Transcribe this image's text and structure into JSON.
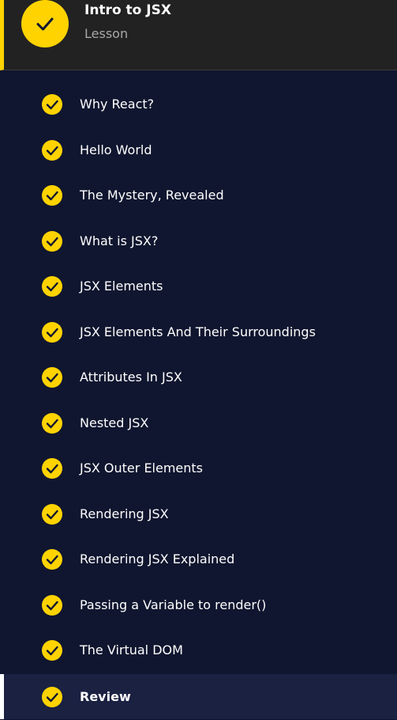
{
  "header": {
    "title": "Intro to JSX",
    "subtitle": "Lesson",
    "badge_icon": "check-icon"
  },
  "colors": {
    "accent": "#ffd300",
    "background": "#10162f",
    "header_bg": "#222222",
    "active_bg": "#1a2141"
  },
  "items": [
    {
      "label": "Why React?",
      "icon": "check-icon",
      "completed": true
    },
    {
      "label": "Hello World",
      "icon": "check-icon",
      "completed": true
    },
    {
      "label": "The Mystery, Revealed",
      "icon": "check-icon",
      "completed": true
    },
    {
      "label": "What is JSX?",
      "icon": "check-icon",
      "completed": true
    },
    {
      "label": "JSX Elements",
      "icon": "check-icon",
      "completed": true
    },
    {
      "label": "JSX Elements And Their Surroundings",
      "icon": "check-icon",
      "completed": true
    },
    {
      "label": "Attributes In JSX",
      "icon": "check-icon",
      "completed": true
    },
    {
      "label": "Nested JSX",
      "icon": "check-icon",
      "completed": true
    },
    {
      "label": "JSX Outer Elements",
      "icon": "check-icon",
      "completed": true
    },
    {
      "label": "Rendering JSX",
      "icon": "check-icon",
      "completed": true
    },
    {
      "label": "Rendering JSX Explained",
      "icon": "check-icon",
      "completed": true
    },
    {
      "label": "Passing a Variable to render()",
      "icon": "check-icon",
      "completed": true
    },
    {
      "label": "The Virtual DOM",
      "icon": "check-icon",
      "completed": true
    },
    {
      "label": "Review",
      "icon": "check-icon",
      "completed": true,
      "active": true
    }
  ]
}
